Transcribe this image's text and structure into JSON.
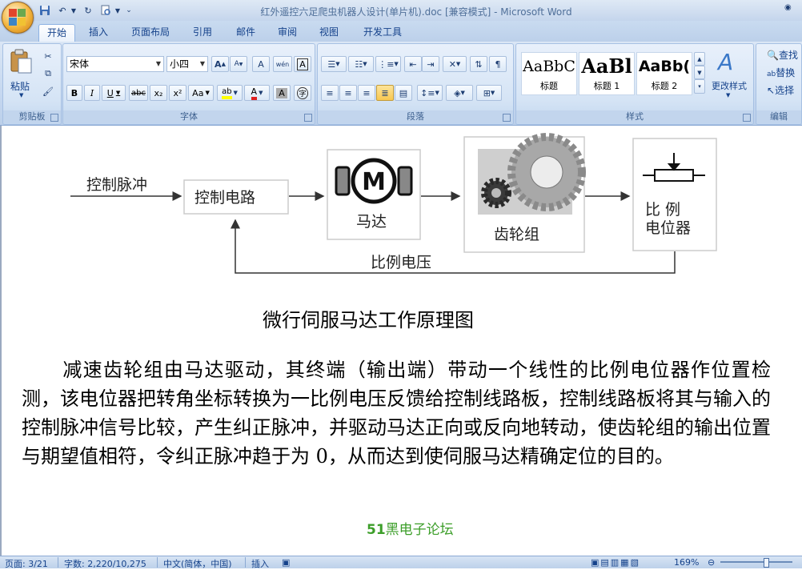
{
  "window": {
    "title": "红外遥控六足爬虫机器人设计(单片机).doc [兼容模式] - Microsoft Word"
  },
  "tabs": [
    "开始",
    "插入",
    "页面布局",
    "引用",
    "邮件",
    "审阅",
    "视图",
    "开发工具"
  ],
  "ribbon": {
    "clipboard": {
      "label": "剪贴板",
      "paste": "粘贴"
    },
    "font": {
      "label": "字体",
      "name": "宋体",
      "size": "小四",
      "grow": "A",
      "shrink": "A",
      "clear": "A",
      "phonetic": "wén",
      "bold": "B",
      "italic": "I",
      "underline": "U",
      "strike": "abc",
      "sub": "x₂",
      "sup": "x²",
      "case": "Aa",
      "shade": "A",
      "enclose": "字"
    },
    "paragraph": {
      "label": "段落"
    },
    "styles": {
      "label": "样式",
      "items": [
        {
          "sample": "AaBbC",
          "name": "标题"
        },
        {
          "sample": "AaBl",
          "name": "标题 1"
        },
        {
          "sample": "AaBb(",
          "name": "标题 2"
        }
      ],
      "change": "更改样式"
    },
    "editing": {
      "label": "编辑",
      "find": "查找",
      "replace": "替换",
      "select": "选择"
    }
  },
  "diagram": {
    "input": "控制脉冲",
    "control": "控制电路",
    "motor": "马达",
    "motor_letter": "M",
    "gears": "齿轮组",
    "pot": "比 例",
    "pot2": "电位器",
    "feedback": "比例电压"
  },
  "document": {
    "caption": "微行伺服马达工作原理图",
    "paragraph": "减速齿轮组由马达驱动，其终端（输出端）带动一个线性的比例电位器作位置检测，该电位器把转角坐标转换为一比例电压反馈给控制线路板，控制线路板将其与输入的控制脉冲信号比较，产生纠正脉冲，并驱动马达正向或反向地转动，使齿轮组的输出位置与期望值相符，令纠正脉冲趋于为 0，从而达到使伺服马达精确定位的目的。",
    "watermark_num": "51",
    "watermark_text": "黑电子论坛"
  },
  "status": {
    "page": "页面: 3/21",
    "words": "字数: 2,220/10,275",
    "language": "中文(简体，中国)",
    "mode": "插入",
    "zoom": "169%"
  },
  "colors": {
    "ribbon": "#c3d6ef",
    "accent": "#15428b",
    "watermark": "#3c9e29"
  }
}
